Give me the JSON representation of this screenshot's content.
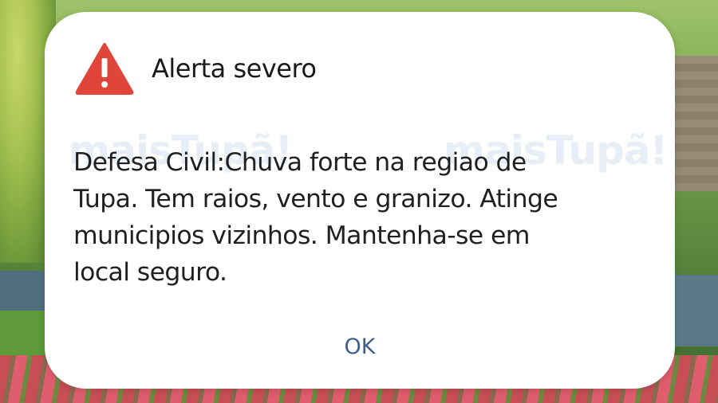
{
  "dialog": {
    "title": "Alerta severo",
    "icon": "warning-triangle-icon",
    "icon_color": "#e0453a",
    "message_lines": [
      "Defesa Civil:Chuva forte na regiao de",
      "Tupa. Tem raios, vento e granizo. Atinge",
      "municipios vizinhos. Mantenha-se em",
      "local seguro."
    ],
    "ok_label": "OK",
    "ok_color": "#3e5f8a"
  },
  "watermark": {
    "left_text": "maisTupã!",
    "right_text": "maisTupã!"
  }
}
